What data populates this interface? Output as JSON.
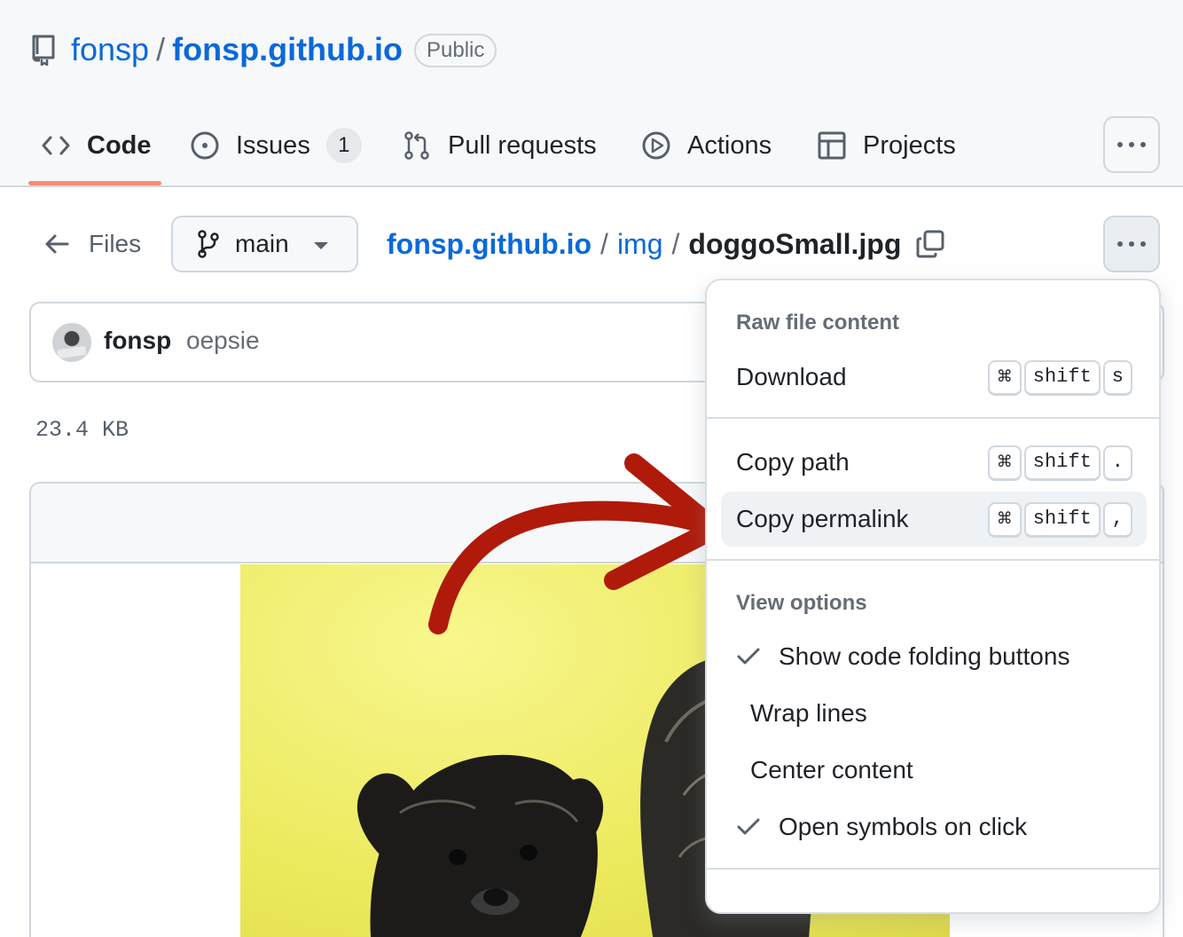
{
  "repo": {
    "owner": "fonsp",
    "separator": "/",
    "name": "fonsp.github.io",
    "visibility": "Public"
  },
  "tabs": [
    {
      "label": "Code",
      "icon": "code-icon",
      "active": true
    },
    {
      "label": "Issues",
      "icon": "issue-opened-icon",
      "count": "1"
    },
    {
      "label": "Pull requests",
      "icon": "git-pull-request-icon"
    },
    {
      "label": "Actions",
      "icon": "play-icon"
    },
    {
      "label": "Projects",
      "icon": "table-icon"
    }
  ],
  "file_nav": {
    "files_label": "Files",
    "branch": "main",
    "breadcrumb": {
      "root": "fonsp.github.io",
      "sep": "/",
      "dir": "img",
      "file": "doggoSmall.jpg"
    }
  },
  "commit": {
    "author": "fonsp",
    "message": "oepsie"
  },
  "file_size": "23.4 KB",
  "menu": {
    "section_raw": "Raw file content",
    "download": {
      "label": "Download",
      "keys": [
        "⌘",
        "shift",
        "s"
      ]
    },
    "copy_path": {
      "label": "Copy path",
      "keys": [
        "⌘",
        "shift",
        "."
      ]
    },
    "copy_permalink": {
      "label": "Copy permalink",
      "keys": [
        "⌘",
        "shift",
        ","
      ]
    },
    "section_view": "View options",
    "view_options": [
      {
        "label": "Show code folding buttons",
        "checked": true
      },
      {
        "label": "Wrap lines",
        "checked": false
      },
      {
        "label": "Center content",
        "checked": false
      },
      {
        "label": "Open symbols on click",
        "checked": true
      }
    ]
  },
  "colors": {
    "link": "#0969da",
    "tab_underline": "#fd8c73",
    "annotation_arrow": "#b01a0a",
    "image_background": "#ece95c"
  }
}
